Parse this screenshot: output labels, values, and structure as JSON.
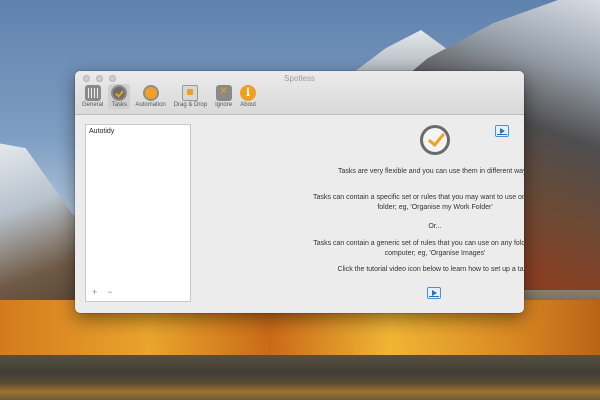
{
  "window": {
    "title": "Spotless"
  },
  "toolbar": {
    "items": [
      {
        "label": "General",
        "icon": "general-icon"
      },
      {
        "label": "Tasks",
        "icon": "tasks-icon",
        "active": true
      },
      {
        "label": "Automation",
        "icon": "automation-icon"
      },
      {
        "label": "Drag & Drop",
        "icon": "drag-drop-icon"
      },
      {
        "label": "Ignore",
        "icon": "ignore-icon"
      },
      {
        "label": "About",
        "icon": "about-icon"
      }
    ]
  },
  "tasks_list": {
    "items": [
      "Autotidy"
    ],
    "add_label": "+",
    "remove_label": "−"
  },
  "main": {
    "intro": "Tasks are very flexible and you can use them in different ways.",
    "option1": "Tasks can contain a specific set or rules that you may want to use on a specific folder; eg, 'Organise my Work Folder'",
    "or": "Or...",
    "option2": "Tasks can contain a generic set of rules that you can use on any folder on your computer; eg, 'Organise Images'",
    "tutorial": "Click the tutorial video icon below to learn how to set up a task."
  },
  "colors": {
    "accent": "#f2a024",
    "video_blue": "#2a6fc0"
  }
}
